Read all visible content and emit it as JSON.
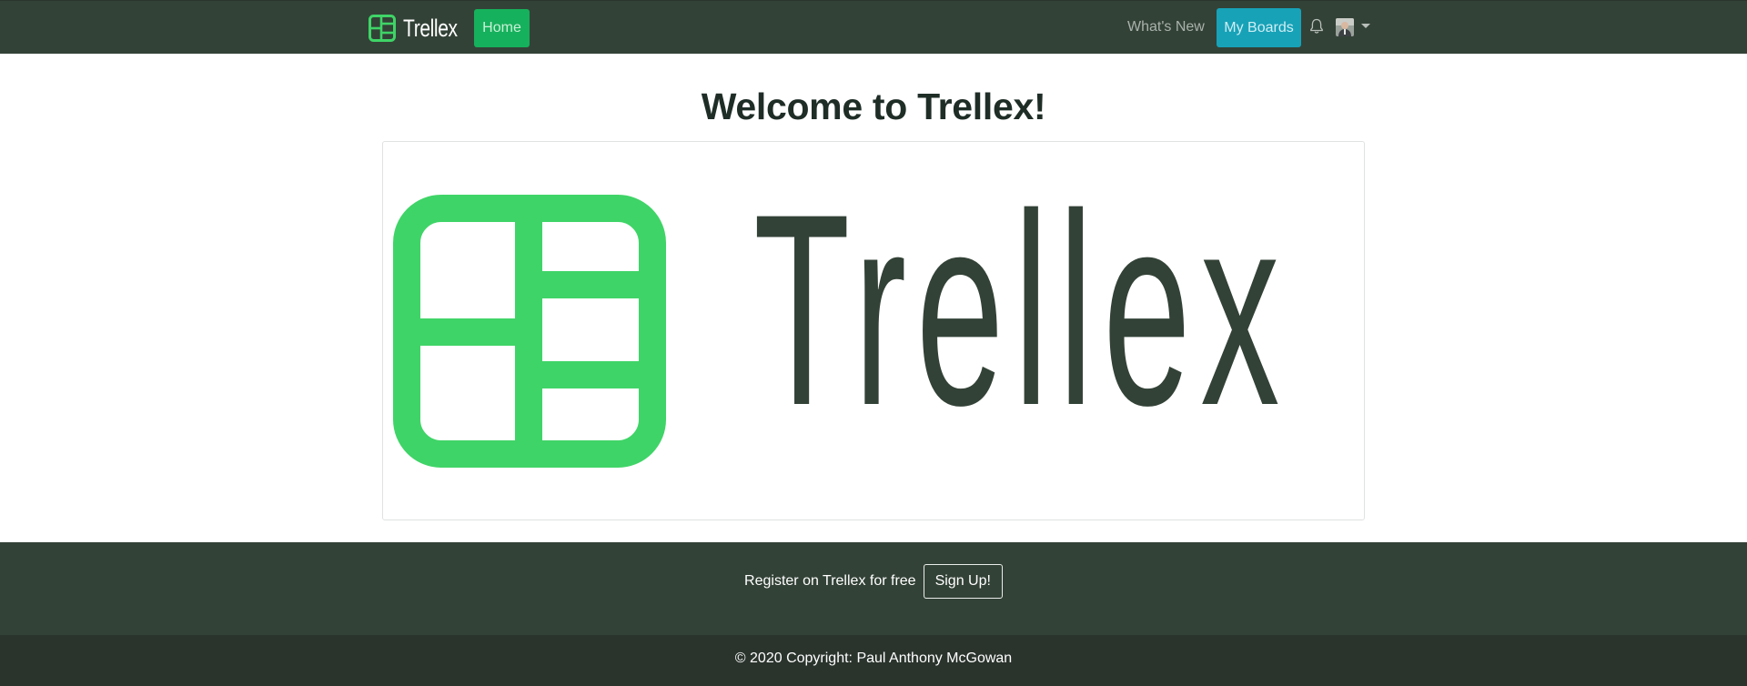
{
  "navbar": {
    "brand": "Trellex",
    "home_label": "Home",
    "whats_new_label": "What's New",
    "my_boards_label": "My Boards",
    "bell_icon": "bell-icon",
    "avatar": "user-avatar",
    "caret_icon": "caret-down-icon"
  },
  "main": {
    "title": "Welcome to Trellex!",
    "hero_logo_text": "Trellex"
  },
  "footer": {
    "register_text": "Register on Trellex for free",
    "signup_label": "Sign Up!",
    "copyright": "© 2020 Copyright: Paul Anthony McGowan"
  },
  "colors": {
    "navbar_bg": "#334237",
    "brand_green": "#3fd467",
    "home_btn": "#16b15c",
    "my_boards_btn": "#17a2b8",
    "footer_bottom_bg": "#2a342d"
  }
}
